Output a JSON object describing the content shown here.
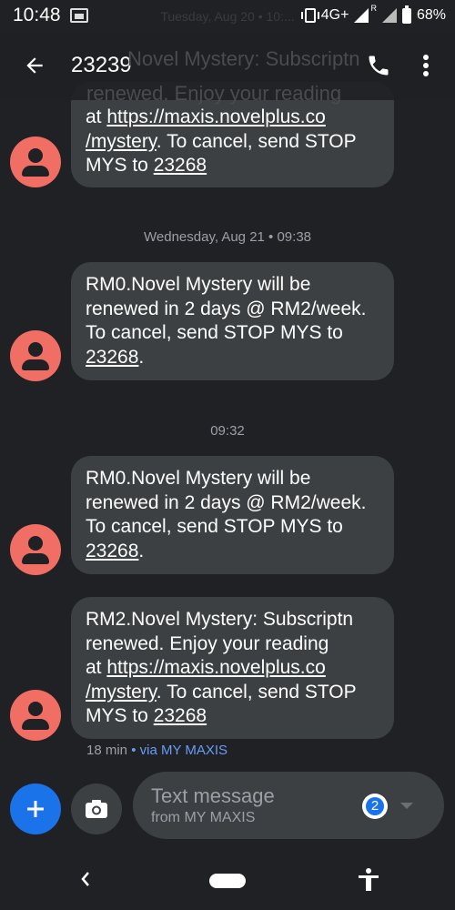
{
  "status": {
    "time": "10:48",
    "network": "4G+",
    "roaming": "R",
    "battery": "68%"
  },
  "header": {
    "title": "23239",
    "behind_date": "Tuesday, Aug 20 • 10:...",
    "behind_text_1": "Novel Mystery: Subscriptn",
    "behind_text_2": "renewed. Enjoy your reading"
  },
  "messages": [
    {
      "pre": "at ",
      "link": "https://maxis.novelplus.co",
      "link2": "/mystery",
      "mid": ". To cancel, send STOP",
      "line3_pre": "MYS to ",
      "number": "23268"
    },
    {
      "date": "Wednesday, Aug 21 • 09:38",
      "l1": "RM0.Novel Mystery will be",
      "l2": "renewed in 2 days @ RM2/week.",
      "l3": "To cancel, send STOP MYS to",
      "number": "23268",
      "end": "."
    },
    {
      "date": "09:32",
      "l1": "RM0.Novel Mystery will be",
      "l2": "renewed in 2 days @ RM2/week.",
      "l3": "To cancel, send STOP MYS to",
      "number": "23268",
      "end": "."
    },
    {
      "l1": "RM2.Novel Mystery: Subscriptn",
      "l2": "renewed. Enjoy your reading",
      "pre": "at ",
      "link": "https://maxis.novelplus.co",
      "link2": "/mystery",
      "mid": ". To cancel, send STOP",
      "line5_pre": "MYS to ",
      "number": "23268"
    }
  ],
  "meta": {
    "age": "18 min",
    "sep": " • ",
    "via": "via MY MAXIS"
  },
  "composer": {
    "placeholder": "Text message",
    "from": "from MY MAXIS",
    "sim": "2"
  },
  "icons": {
    "back": "arrow-left-icon",
    "call": "phone-icon",
    "more": "more-vert-icon",
    "add": "plus-icon",
    "camera": "camera-icon",
    "nav_back": "chevron-left-icon",
    "a11y": "accessibility-icon"
  },
  "colors": {
    "accent": "#1a73e8",
    "avatar": "#f06e64",
    "bubble": "#3c4043",
    "background": "#202124"
  }
}
